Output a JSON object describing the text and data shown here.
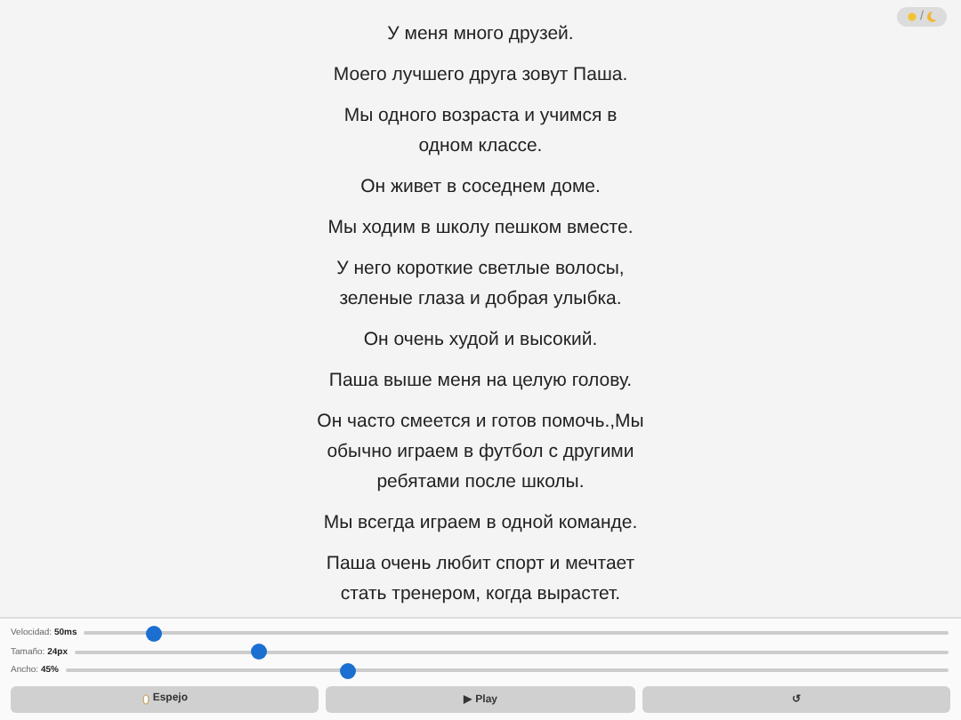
{
  "theme_toggle": {
    "separator": "/"
  },
  "paragraphs": [
    "У меня много друзей.",
    "Моего лучшего друга зовут Паша.",
    "Мы одного возраста и учимся в одном классе.",
    "Он живет в соседнем доме.",
    "Мы ходим в школу пешком вместе.",
    "У него короткие светлые волосы, зеленые глаза и добрая улыбка.",
    "Он очень худой и высокий.",
    "Паша выше меня на целую голову.",
    "Он часто смеется и готов помочь.,Мы обычно играем в футбол с другими ребятами после школы.",
    "Мы всегда играем в одной команде.",
    "Паша очень любит спорт и мечтает стать тренером, когда вырастет."
  ],
  "sliders": [
    {
      "label": "Velocidad: **50ms**",
      "level": 0.08
    },
    {
      "label": "Tamaño: **24px**",
      "level": 0.21
    },
    {
      "label": "Ancho: **45%**",
      "level": 0.32
    }
  ],
  "buttons": [
    {
      "kind": "mirror",
      "label": "Espejo"
    },
    {
      "kind": "play",
      "label": "▶ Play"
    },
    {
      "kind": "reset",
      "label": "↺"
    }
  ]
}
